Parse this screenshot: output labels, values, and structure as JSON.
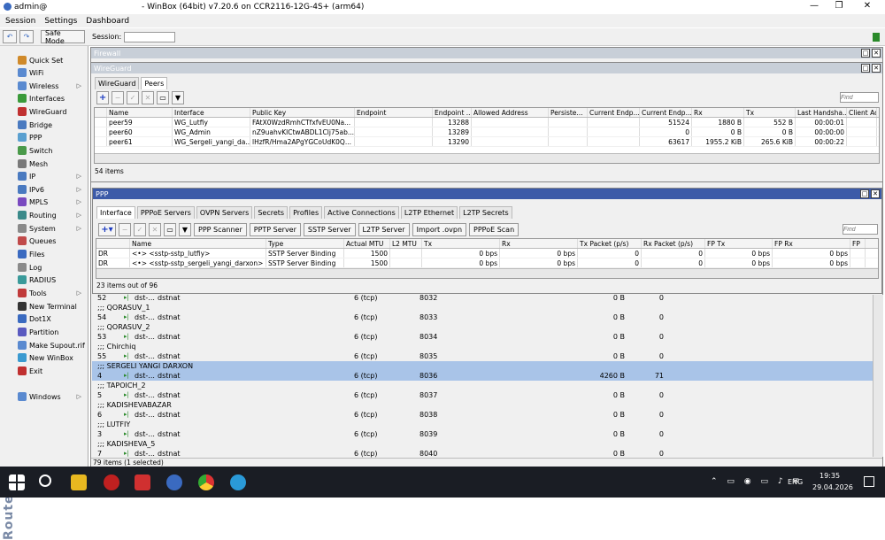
{
  "title": {
    "user": "admin@",
    "window_title": "- WinBox (64bit) v7.20.6 on CCR2116-12G-4S+ (arm64)",
    "minimize": "—",
    "restore": "❐",
    "close": "✕"
  },
  "menu": [
    "Session",
    "Settings",
    "Dashboard"
  ],
  "toolbar": {
    "undo": "↶",
    "redo": "↷",
    "safe_mode": "Safe Mode",
    "session_label": "Session:",
    "session_value": ""
  },
  "brand_vertical": "RouterOS WinBox",
  "sidebar": [
    {
      "label": "Quick Set",
      "color": "#d08a2a",
      "arrow": ""
    },
    {
      "label": "WiFi",
      "color": "#5a8ad0",
      "arrow": ""
    },
    {
      "label": "Wireless",
      "color": "#5a8ad0",
      "arrow": "▷"
    },
    {
      "label": "Interfaces",
      "color": "#3a9a3a",
      "arrow": ""
    },
    {
      "label": "WireGuard",
      "color": "#c03030",
      "arrow": ""
    },
    {
      "label": "Bridge",
      "color": "#4a7ac0",
      "arrow": ""
    },
    {
      "label": "PPP",
      "color": "#5aa0d0",
      "arrow": ""
    },
    {
      "label": "Switch",
      "color": "#4a9a4a",
      "arrow": ""
    },
    {
      "label": "Mesh",
      "color": "#7a7a7a",
      "arrow": ""
    },
    {
      "label": "IP",
      "color": "#4a7ac0",
      "arrow": "▷"
    },
    {
      "label": "IPv6",
      "color": "#4a7ac0",
      "arrow": "▷"
    },
    {
      "label": "MPLS",
      "color": "#7a4ac0",
      "arrow": "▷"
    },
    {
      "label": "Routing",
      "color": "#3a8a8a",
      "arrow": "▷"
    },
    {
      "label": "System",
      "color": "#8a8a8a",
      "arrow": "▷"
    },
    {
      "label": "Queues",
      "color": "#c04a4a",
      "arrow": ""
    },
    {
      "label": "Files",
      "color": "#3a6ac0",
      "arrow": ""
    },
    {
      "label": "Log",
      "color": "#8a8a8a",
      "arrow": ""
    },
    {
      "label": "RADIUS",
      "color": "#3a9a9a",
      "arrow": ""
    },
    {
      "label": "Tools",
      "color": "#c03a3a",
      "arrow": "▷"
    },
    {
      "label": "New Terminal",
      "color": "#333333",
      "arrow": ""
    },
    {
      "label": "Dot1X",
      "color": "#3a6ac0",
      "arrow": ""
    },
    {
      "label": "Partition",
      "color": "#5a5ac0",
      "arrow": ""
    },
    {
      "label": "Make Supout.rif",
      "color": "#5a8ad0",
      "arrow": ""
    },
    {
      "label": "New WinBox",
      "color": "#3a9ad0",
      "arrow": ""
    },
    {
      "label": "Exit",
      "color": "#c03030",
      "arrow": ""
    },
    {
      "label": "Windows",
      "color": "#5a8ad0",
      "arrow": "▷"
    }
  ],
  "firewall": {
    "title": "Firewall"
  },
  "wireguard": {
    "title": "WireGuard",
    "tabs": [
      "WireGuard",
      "Peers"
    ],
    "find_placeholder": "Find",
    "columns": [
      "Name",
      "Interface",
      "Public Key",
      "Endpoint",
      "Endpoint ...",
      "Allowed Address",
      "Persiste...",
      "Current Endp...",
      "Current Endp...",
      "Rx",
      "Tx",
      "Last Handsha...",
      "Client Ad"
    ],
    "rows": [
      [
        "peer59",
        "WG_Lutfiy",
        "FAtX0WzdRmhCTfxfvEU0Na...",
        "",
        "13288",
        "",
        "",
        "",
        "51524",
        "1880 B",
        "552 B",
        "00:00:01",
        ""
      ],
      [
        "peer60",
        "WG_Admin",
        "nZ9uahvKlCtwABDL1Clj75ab...",
        "",
        "13289",
        "",
        "",
        "",
        "0",
        "0 B",
        "0 B",
        "00:00:00",
        ""
      ],
      [
        "peer61",
        "WG_Sergeli_yangi_da...",
        "lHzfR/Hma2APgYGCoUdK0Q...",
        "",
        "13290",
        "",
        "",
        "",
        "63617",
        "1955.2 KiB",
        "265.6 KiB",
        "00:00:22",
        ""
      ]
    ],
    "status": "54 items"
  },
  "ppp": {
    "title": "PPP",
    "tabs": [
      "Interface",
      "PPPoE Servers",
      "OVPN Servers",
      "Secrets",
      "Profiles",
      "Active Connections",
      "L2TP Ethernet",
      "L2TP Secrets"
    ],
    "buttons": [
      "PPP Scanner",
      "PPTP Server",
      "SSTP Server",
      "L2TP Server",
      "Import .ovpn",
      "PPPoE Scan"
    ],
    "find_placeholder": "Find",
    "columns": [
      "",
      "Name",
      "Type",
      "Actual MTU",
      "L2 MTU",
      "Tx",
      "Rx",
      "Tx Packet (p/s)",
      "Rx Packet (p/s)",
      "FP Tx",
      "FP Rx",
      "FP"
    ],
    "rows": [
      [
        "DR",
        "<•> <sstp-sstp_lutfiy>",
        "SSTP Server Binding",
        "1500",
        "",
        "0 bps",
        "0 bps",
        "0",
        "0",
        "0 bps",
        "0 bps",
        ""
      ],
      [
        "DR",
        "<•> <sstp-sstp_sergeli_yangi_darxon>",
        "SSTP Server Binding",
        "1500",
        "",
        "0 bps",
        "0 bps",
        "0",
        "0",
        "0 bps",
        "0 bps",
        ""
      ]
    ],
    "status": "23 items out of 96"
  },
  "nat_rows": [
    {
      "type": "rule",
      "num": "52",
      "action": "dst-...",
      "chain": "dstnat",
      "proto": "6 (tcp)",
      "port": "8032",
      "bytes": "0 B",
      "packets": "0"
    },
    {
      "type": "comment",
      "text": ";;; QORASUV_1"
    },
    {
      "type": "rule",
      "num": "54",
      "action": "dst-...",
      "chain": "dstnat",
      "proto": "6 (tcp)",
      "port": "8033",
      "bytes": "0 B",
      "packets": "0"
    },
    {
      "type": "comment",
      "text": ";;; QORASUV_2"
    },
    {
      "type": "rule",
      "num": "53",
      "action": "dst-...",
      "chain": "dstnat",
      "proto": "6 (tcp)",
      "port": "8034",
      "bytes": "0 B",
      "packets": "0"
    },
    {
      "type": "comment",
      "text": ";;; Chirchiq"
    },
    {
      "type": "rule",
      "num": "55",
      "action": "dst-...",
      "chain": "dstnat",
      "proto": "6 (tcp)",
      "port": "8035",
      "bytes": "0 B",
      "packets": "0"
    },
    {
      "type": "comment",
      "text": ";;; SERGELI YANGI DARXON",
      "selected": true
    },
    {
      "type": "rule",
      "num": "4",
      "action": "dst-...",
      "chain": "dstnat",
      "proto": "6 (tcp)",
      "port": "8036",
      "bytes": "4260 B",
      "packets": "71",
      "selected": true
    },
    {
      "type": "comment",
      "text": ";;; TAPOICH_2"
    },
    {
      "type": "rule",
      "num": "5",
      "action": "dst-...",
      "chain": "dstnat",
      "proto": "6 (tcp)",
      "port": "8037",
      "bytes": "0 B",
      "packets": "0"
    },
    {
      "type": "comment",
      "text": ";;; KADISHEVABAZAR"
    },
    {
      "type": "rule",
      "num": "6",
      "action": "dst-...",
      "chain": "dstnat",
      "proto": "6 (tcp)",
      "port": "8038",
      "bytes": "0 B",
      "packets": "0"
    },
    {
      "type": "comment",
      "text": ";;; LUTFIY"
    },
    {
      "type": "rule",
      "num": "3",
      "action": "dst-...",
      "chain": "dstnat",
      "proto": "6 (tcp)",
      "port": "8039",
      "bytes": "0 B",
      "packets": "0"
    },
    {
      "type": "comment",
      "text": ";;; KADISHEVA_5"
    },
    {
      "type": "rule",
      "num": "7",
      "action": "dst-...",
      "chain": "dstnat",
      "proto": "6 (tcp)",
      "port": "8040",
      "bytes": "0 B",
      "packets": "0"
    }
  ],
  "firewall_status": "79 items (1 selected)",
  "taskbar": {
    "lang": "ENG",
    "time": "19:35",
    "date": "29.04.2026"
  }
}
